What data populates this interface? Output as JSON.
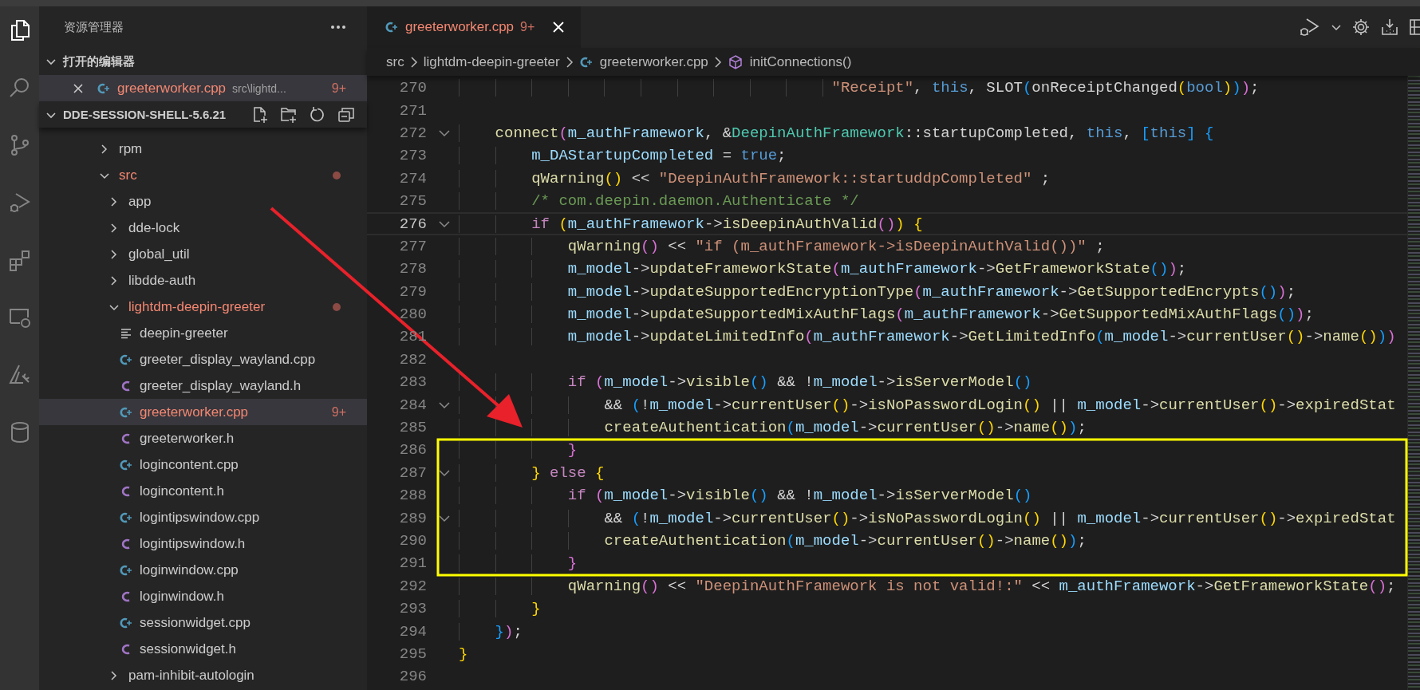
{
  "activity_bar": [
    {
      "kind": "files",
      "selected": true
    },
    {
      "kind": "search",
      "selected": false
    },
    {
      "kind": "source-control",
      "selected": false
    },
    {
      "kind": "run-debug",
      "selected": false
    },
    {
      "kind": "extensions",
      "selected": false
    },
    {
      "kind": "remote",
      "selected": false
    },
    {
      "kind": "triangle-tool",
      "selected": false
    },
    {
      "kind": "database",
      "selected": false
    }
  ],
  "explorer": {
    "title": "资源管理器",
    "open_editors": {
      "title": "打开的编辑器",
      "expanded": true,
      "items": [
        {
          "name": "greeterworker.cpp",
          "path": "src\\lightd...",
          "problems": "9+",
          "kind": "cpp",
          "error": true,
          "selected": true
        }
      ]
    },
    "project": {
      "title": "DDE-SESSION-SHELL-5.6.21",
      "expanded": true,
      "tree": [
        {
          "name": "rpm",
          "kind": "folder",
          "expanded": false,
          "error": false,
          "selected": false
        },
        {
          "name": "src",
          "kind": "folder",
          "expanded": true,
          "error": true,
          "selected": false,
          "children": [
            {
              "name": "app",
              "kind": "folder",
              "expanded": false,
              "error": false,
              "selected": false
            },
            {
              "name": "dde-lock",
              "kind": "folder",
              "expanded": false,
              "error": false,
              "selected": false
            },
            {
              "name": "global_util",
              "kind": "folder",
              "expanded": false,
              "error": false,
              "selected": false
            },
            {
              "name": "libdde-auth",
              "kind": "folder",
              "expanded": false,
              "error": false,
              "selected": false
            },
            {
              "name": "lightdm-deepin-greeter",
              "kind": "folder",
              "expanded": true,
              "error": true,
              "selected": false,
              "children": [
                {
                  "name": "deepin-greeter",
                  "kind": "plain",
                  "error": false,
                  "selected": false
                },
                {
                  "name": "greeter_display_wayland.cpp",
                  "kind": "cpp",
                  "error": false,
                  "selected": false
                },
                {
                  "name": "greeter_display_wayland.h",
                  "kind": "header",
                  "error": false,
                  "selected": false
                },
                {
                  "name": "greeterworker.cpp",
                  "kind": "cpp",
                  "error": true,
                  "selected": true,
                  "problems": "9+"
                },
                {
                  "name": "greeterworker.h",
                  "kind": "header",
                  "error": false,
                  "selected": false
                },
                {
                  "name": "logincontent.cpp",
                  "kind": "cpp",
                  "error": false,
                  "selected": false
                },
                {
                  "name": "logincontent.h",
                  "kind": "header",
                  "error": false,
                  "selected": false
                },
                {
                  "name": "logintipswindow.cpp",
                  "kind": "cpp",
                  "error": false,
                  "selected": false
                },
                {
                  "name": "logintipswindow.h",
                  "kind": "header",
                  "error": false,
                  "selected": false
                },
                {
                  "name": "loginwindow.cpp",
                  "kind": "cpp",
                  "error": false,
                  "selected": false
                },
                {
                  "name": "loginwindow.h",
                  "kind": "header",
                  "error": false,
                  "selected": false
                },
                {
                  "name": "sessionwidget.cpp",
                  "kind": "cpp",
                  "error": false,
                  "selected": false
                },
                {
                  "name": "sessionwidget.h",
                  "kind": "header",
                  "error": false,
                  "selected": false
                }
              ]
            },
            {
              "name": "pam-inhibit-autologin",
              "kind": "folder",
              "expanded": false,
              "error": false,
              "selected": false
            }
          ]
        }
      ]
    }
  },
  "editor": {
    "tabs": [
      {
        "name": "greeterworker.cpp",
        "problems": "9+",
        "kind": "cpp",
        "error": true,
        "selected": true
      }
    ],
    "breadcrumb": [
      {
        "text": "src",
        "kind": "folder"
      },
      {
        "text": "lightdm-deepin-greeter",
        "kind": "folder"
      },
      {
        "text": "greeterworker.cpp",
        "kind": "cpp"
      },
      {
        "text": "initConnections()",
        "kind": "method"
      }
    ],
    "lines": [
      {
        "number": "270",
        "fold": false,
        "current": false,
        "tokens": [
          {
            "kind": "string",
            "text": "                                         \"Receipt\""
          },
          {
            "kind": "plain",
            "text": ", "
          },
          {
            "kind": "keyword",
            "text": "this"
          },
          {
            "kind": "plain",
            "text": ", SLOT"
          },
          {
            "kind": "bracket3",
            "text": "("
          },
          {
            "kind": "plain",
            "text": "onReceiptChanged"
          },
          {
            "kind": "bracket1",
            "text": "("
          },
          {
            "kind": "keyword",
            "text": "bool"
          },
          {
            "kind": "bracket1",
            "text": ")"
          },
          {
            "kind": "bracket3",
            "text": ")"
          },
          {
            "kind": "bracket2",
            "text": ")"
          },
          {
            "kind": "plain",
            "text": ";"
          }
        ]
      },
      {
        "number": "271",
        "fold": false,
        "current": false
      },
      {
        "number": "272",
        "fold": true,
        "current": false,
        "tokens": [
          {
            "kind": "func",
            "text": "    connect"
          },
          {
            "kind": "bracket2",
            "text": "("
          },
          {
            "kind": "var",
            "text": "m_authFramework"
          },
          {
            "kind": "plain",
            "text": ", &"
          },
          {
            "kind": "type",
            "text": "DeepinAuthFramework"
          },
          {
            "kind": "plain",
            "text": "::startupCompleted, "
          },
          {
            "kind": "keyword",
            "text": "this"
          },
          {
            "kind": "plain",
            "text": ", "
          },
          {
            "kind": "bracket3",
            "text": "["
          },
          {
            "kind": "keyword",
            "text": "this"
          },
          {
            "kind": "bracket3",
            "text": "] {"
          }
        ]
      },
      {
        "number": "273",
        "fold": false,
        "current": false,
        "tokens": [
          {
            "kind": "var",
            "text": "        m_DAStartupCompleted"
          },
          {
            "kind": "plain",
            "text": " = "
          },
          {
            "kind": "keyword",
            "text": "true"
          },
          {
            "kind": "plain",
            "text": ";"
          }
        ]
      },
      {
        "number": "274",
        "fold": false,
        "current": false,
        "tokens": [
          {
            "kind": "func",
            "text": "        qWarning"
          },
          {
            "kind": "bracket1",
            "text": "()"
          },
          {
            "kind": "plain",
            "text": " << "
          },
          {
            "kind": "string",
            "text": "\"DeepinAuthFramework::startuddpCompleted\""
          },
          {
            "kind": "plain",
            "text": " ;"
          }
        ]
      },
      {
        "number": "275",
        "fold": false,
        "current": false,
        "tokens": [
          {
            "kind": "comment",
            "text": "        /* com.deepin.daemon.Authenticate */"
          }
        ]
      },
      {
        "number": "276",
        "fold": true,
        "current": true,
        "tokens": [
          {
            "kind": "control",
            "text": "        if "
          },
          {
            "kind": "bracket1",
            "text": "("
          },
          {
            "kind": "var",
            "text": "m_authFramework"
          },
          {
            "kind": "plain",
            "text": "->"
          },
          {
            "kind": "func",
            "text": "isDeepinAuthValid"
          },
          {
            "kind": "bracket2",
            "text": "()"
          },
          {
            "kind": "bracket1",
            "text": ") {"
          }
        ]
      },
      {
        "number": "277",
        "fold": false,
        "current": false,
        "tokens": [
          {
            "kind": "func",
            "text": "            qWarning"
          },
          {
            "kind": "bracket2",
            "text": "()"
          },
          {
            "kind": "plain",
            "text": " << "
          },
          {
            "kind": "string",
            "text": "\"if (m_authFramework->isDeepinAuthValid())\""
          },
          {
            "kind": "plain",
            "text": " ;"
          }
        ]
      },
      {
        "number": "278",
        "fold": false,
        "current": false,
        "tokens": [
          {
            "kind": "var",
            "text": "            m_model"
          },
          {
            "kind": "plain",
            "text": "->"
          },
          {
            "kind": "func",
            "text": "updateFrameworkState"
          },
          {
            "kind": "bracket2",
            "text": "("
          },
          {
            "kind": "var",
            "text": "m_authFramework"
          },
          {
            "kind": "plain",
            "text": "->"
          },
          {
            "kind": "func",
            "text": "GetFrameworkState"
          },
          {
            "kind": "bracket3",
            "text": "()"
          },
          {
            "kind": "bracket2",
            "text": ")"
          },
          {
            "kind": "plain",
            "text": ";"
          }
        ]
      },
      {
        "number": "279",
        "fold": false,
        "current": false,
        "tokens": [
          {
            "kind": "var",
            "text": "            m_model"
          },
          {
            "kind": "plain",
            "text": "->"
          },
          {
            "kind": "func",
            "text": "updateSupportedEncryptionType"
          },
          {
            "kind": "bracket2",
            "text": "("
          },
          {
            "kind": "var",
            "text": "m_authFramework"
          },
          {
            "kind": "plain",
            "text": "->"
          },
          {
            "kind": "func",
            "text": "GetSupportedEncrypts"
          },
          {
            "kind": "bracket3",
            "text": "()"
          },
          {
            "kind": "bracket2",
            "text": ")"
          },
          {
            "kind": "plain",
            "text": ";"
          }
        ]
      },
      {
        "number": "280",
        "fold": false,
        "current": false,
        "tokens": [
          {
            "kind": "var",
            "text": "            m_model"
          },
          {
            "kind": "plain",
            "text": "->"
          },
          {
            "kind": "func",
            "text": "updateSupportedMixAuthFlags"
          },
          {
            "kind": "bracket2",
            "text": "("
          },
          {
            "kind": "var",
            "text": "m_authFramework"
          },
          {
            "kind": "plain",
            "text": "->"
          },
          {
            "kind": "func",
            "text": "GetSupportedMixAuthFlags"
          },
          {
            "kind": "bracket3",
            "text": "()"
          },
          {
            "kind": "bracket2",
            "text": ")"
          },
          {
            "kind": "plain",
            "text": ";"
          }
        ]
      },
      {
        "number": "281",
        "fold": false,
        "current": false,
        "tokens": [
          {
            "kind": "var",
            "text": "            m_model"
          },
          {
            "kind": "plain",
            "text": "->"
          },
          {
            "kind": "func",
            "text": "updateLimitedInfo"
          },
          {
            "kind": "bracket2",
            "text": "("
          },
          {
            "kind": "var",
            "text": "m_authFramework"
          },
          {
            "kind": "plain",
            "text": "->"
          },
          {
            "kind": "func",
            "text": "GetLimitedInfo"
          },
          {
            "kind": "bracket3",
            "text": "("
          },
          {
            "kind": "var",
            "text": "m_model"
          },
          {
            "kind": "plain",
            "text": "->"
          },
          {
            "kind": "func",
            "text": "currentUser"
          },
          {
            "kind": "bracket1",
            "text": "()"
          },
          {
            "kind": "plain",
            "text": "->"
          },
          {
            "kind": "func",
            "text": "name"
          },
          {
            "kind": "bracket1",
            "text": "()"
          },
          {
            "kind": "bracket3",
            "text": ")"
          },
          {
            "kind": "bracket2",
            "text": ")"
          }
        ]
      },
      {
        "number": "282",
        "fold": false,
        "current": false
      },
      {
        "number": "283",
        "fold": false,
        "current": false,
        "tokens": [
          {
            "kind": "control",
            "text": "            if "
          },
          {
            "kind": "bracket2",
            "text": "("
          },
          {
            "kind": "var",
            "text": "m_model"
          },
          {
            "kind": "plain",
            "text": "->"
          },
          {
            "kind": "func",
            "text": "visible"
          },
          {
            "kind": "bracket3",
            "text": "()"
          },
          {
            "kind": "plain",
            "text": " && !"
          },
          {
            "kind": "var",
            "text": "m_model"
          },
          {
            "kind": "plain",
            "text": "->"
          },
          {
            "kind": "func",
            "text": "isServerModel"
          },
          {
            "kind": "bracket3",
            "text": "()"
          }
        ]
      },
      {
        "number": "284",
        "fold": true,
        "current": false,
        "tokens": [
          {
            "kind": "plain",
            "text": "                && "
          },
          {
            "kind": "bracket3",
            "text": "("
          },
          {
            "kind": "plain",
            "text": "!"
          },
          {
            "kind": "var",
            "text": "m_model"
          },
          {
            "kind": "plain",
            "text": "->"
          },
          {
            "kind": "func",
            "text": "currentUser"
          },
          {
            "kind": "bracket1",
            "text": "()"
          },
          {
            "kind": "plain",
            "text": "->"
          },
          {
            "kind": "func",
            "text": "isNoPasswordLogin"
          },
          {
            "kind": "bracket1",
            "text": "()"
          },
          {
            "kind": "plain",
            "text": " || "
          },
          {
            "kind": "var",
            "text": "m_model"
          },
          {
            "kind": "plain",
            "text": "->"
          },
          {
            "kind": "func",
            "text": "currentUser"
          },
          {
            "kind": "bracket1",
            "text": "()"
          },
          {
            "kind": "plain",
            "text": "->"
          },
          {
            "kind": "func",
            "text": "expiredStat"
          }
        ]
      },
      {
        "number": "285",
        "fold": false,
        "current": false,
        "tokens": [
          {
            "kind": "func",
            "text": "                createAuthentication"
          },
          {
            "kind": "bracket3",
            "text": "("
          },
          {
            "kind": "var",
            "text": "m_model"
          },
          {
            "kind": "plain",
            "text": "->"
          },
          {
            "kind": "func",
            "text": "currentUser"
          },
          {
            "kind": "bracket1",
            "text": "()"
          },
          {
            "kind": "plain",
            "text": "->"
          },
          {
            "kind": "func",
            "text": "name"
          },
          {
            "kind": "bracket1",
            "text": "()"
          },
          {
            "kind": "bracket3",
            "text": ")"
          },
          {
            "kind": "plain",
            "text": ";"
          }
        ]
      },
      {
        "number": "286",
        "fold": false,
        "current": false,
        "tokens": [
          {
            "kind": "bracket2",
            "text": "            }"
          }
        ]
      },
      {
        "number": "287",
        "fold": true,
        "current": false,
        "tokens": [
          {
            "kind": "bracket1",
            "text": "        } "
          },
          {
            "kind": "control",
            "text": "else "
          },
          {
            "kind": "bracket1",
            "text": "{"
          }
        ]
      },
      {
        "number": "288",
        "fold": false,
        "current": false,
        "tokens": [
          {
            "kind": "control",
            "text": "            if "
          },
          {
            "kind": "bracket2",
            "text": "("
          },
          {
            "kind": "var",
            "text": "m_model"
          },
          {
            "kind": "plain",
            "text": "->"
          },
          {
            "kind": "func",
            "text": "visible"
          },
          {
            "kind": "bracket3",
            "text": "()"
          },
          {
            "kind": "plain",
            "text": " && !"
          },
          {
            "kind": "var",
            "text": "m_model"
          },
          {
            "kind": "plain",
            "text": "->"
          },
          {
            "kind": "func",
            "text": "isServerModel"
          },
          {
            "kind": "bracket3",
            "text": "()"
          }
        ]
      },
      {
        "number": "289",
        "fold": true,
        "current": false,
        "tokens": [
          {
            "kind": "plain",
            "text": "                && "
          },
          {
            "kind": "bracket3",
            "text": "("
          },
          {
            "kind": "plain",
            "text": "!"
          },
          {
            "kind": "var",
            "text": "m_model"
          },
          {
            "kind": "plain",
            "text": "->"
          },
          {
            "kind": "func",
            "text": "currentUser"
          },
          {
            "kind": "bracket1",
            "text": "()"
          },
          {
            "kind": "plain",
            "text": "->"
          },
          {
            "kind": "func",
            "text": "isNoPasswordLogin"
          },
          {
            "kind": "bracket1",
            "text": "()"
          },
          {
            "kind": "plain",
            "text": " || "
          },
          {
            "kind": "var",
            "text": "m_model"
          },
          {
            "kind": "plain",
            "text": "->"
          },
          {
            "kind": "func",
            "text": "currentUser"
          },
          {
            "kind": "bracket1",
            "text": "()"
          },
          {
            "kind": "plain",
            "text": "->"
          },
          {
            "kind": "func",
            "text": "expiredStat"
          }
        ]
      },
      {
        "number": "290",
        "fold": false,
        "current": false,
        "tokens": [
          {
            "kind": "func",
            "text": "                createAuthentication"
          },
          {
            "kind": "bracket3",
            "text": "("
          },
          {
            "kind": "var",
            "text": "m_model"
          },
          {
            "kind": "plain",
            "text": "->"
          },
          {
            "kind": "func",
            "text": "currentUser"
          },
          {
            "kind": "bracket1",
            "text": "()"
          },
          {
            "kind": "plain",
            "text": "->"
          },
          {
            "kind": "func",
            "text": "name"
          },
          {
            "kind": "bracket1",
            "text": "()"
          },
          {
            "kind": "bracket3",
            "text": ")"
          },
          {
            "kind": "plain",
            "text": ";"
          }
        ]
      },
      {
        "number": "291",
        "fold": false,
        "current": false,
        "tokens": [
          {
            "kind": "bracket2",
            "text": "            }"
          }
        ]
      },
      {
        "number": "292",
        "fold": false,
        "current": false,
        "tokens": [
          {
            "kind": "func",
            "text": "            qWarning"
          },
          {
            "kind": "bracket2",
            "text": "()"
          },
          {
            "kind": "plain",
            "text": " << "
          },
          {
            "kind": "string",
            "text": "\"DeepinAuthFramework is not valid!:\""
          },
          {
            "kind": "plain",
            "text": " << "
          },
          {
            "kind": "var",
            "text": "m_authFramework"
          },
          {
            "kind": "plain",
            "text": "->"
          },
          {
            "kind": "func",
            "text": "GetFrameworkState"
          },
          {
            "kind": "bracket2",
            "text": "()"
          },
          {
            "kind": "plain",
            "text": ";"
          }
        ]
      },
      {
        "number": "293",
        "fold": false,
        "current": false,
        "tokens": [
          {
            "kind": "bracket1",
            "text": "        }"
          }
        ]
      },
      {
        "number": "294",
        "fold": false,
        "current": false,
        "tokens": [
          {
            "kind": "bracket3",
            "text": "    }"
          },
          {
            "kind": "bracket2",
            "text": ")"
          },
          {
            "kind": "plain",
            "text": ";"
          }
        ]
      },
      {
        "number": "295",
        "fold": false,
        "current": false,
        "tokens": [
          {
            "kind": "bracket1",
            "text": "}"
          }
        ]
      },
      {
        "number": "296",
        "fold": false,
        "current": false
      }
    ]
  }
}
